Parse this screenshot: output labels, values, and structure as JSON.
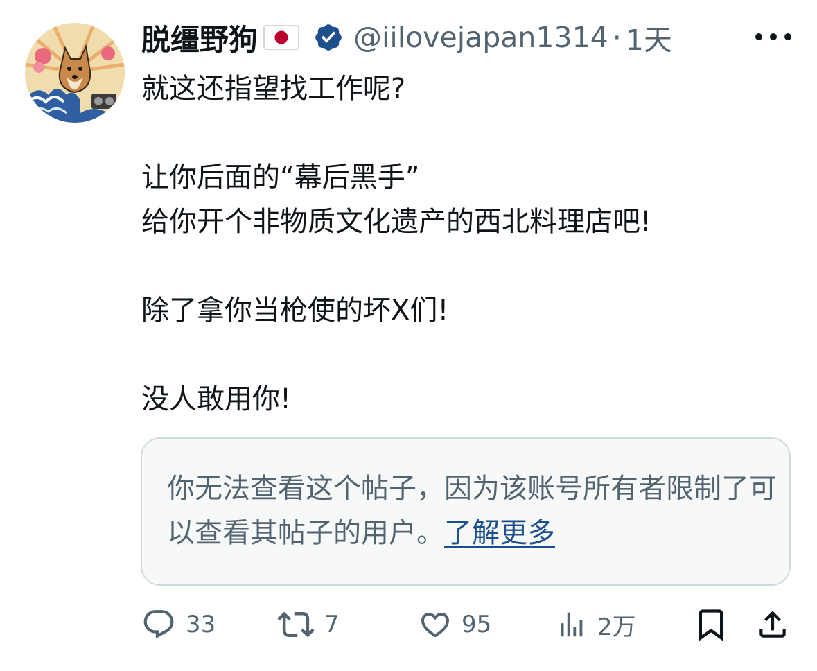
{
  "post": {
    "author": {
      "display_name": "脱缰野狗",
      "flag": "🇯🇵",
      "handle": "@iilovejapan1314",
      "verified": true,
      "avatar": "shiba-dog-wave-art-avatar"
    },
    "separator": "·",
    "time": "1天",
    "text_lines": [
      "就这还指望找工作呢?",
      "",
      "让你后面的“幕后黑手”",
      "给你开个非物质文化遗产的西北料理店吧!",
      "",
      "除了拿你当枪使的坏X们!",
      "",
      "没人敢用你!"
    ],
    "quote_notice": {
      "text": "你无法查看这个帖子，因为该账号所有者限制了可以查看其帖子的用户。",
      "link_text": "了解更多"
    },
    "actions": {
      "replies": "33",
      "reposts": "7",
      "likes": "95",
      "views": "2万"
    }
  },
  "colors": {
    "primary_text": "#0f1419",
    "secondary_text": "#536471",
    "verified_badge": "#1d4f8c",
    "link": "#1d4f8c",
    "border": "#cfd9de",
    "quote_bg": "#f7f9f9"
  },
  "icons": {
    "more": "more-horizontal-icon",
    "reply": "reply-icon",
    "repost": "repost-icon",
    "like": "heart-icon",
    "views": "analytics-icon",
    "bookmark": "bookmark-icon",
    "share": "share-icon",
    "verified": "verified-badge-icon"
  }
}
